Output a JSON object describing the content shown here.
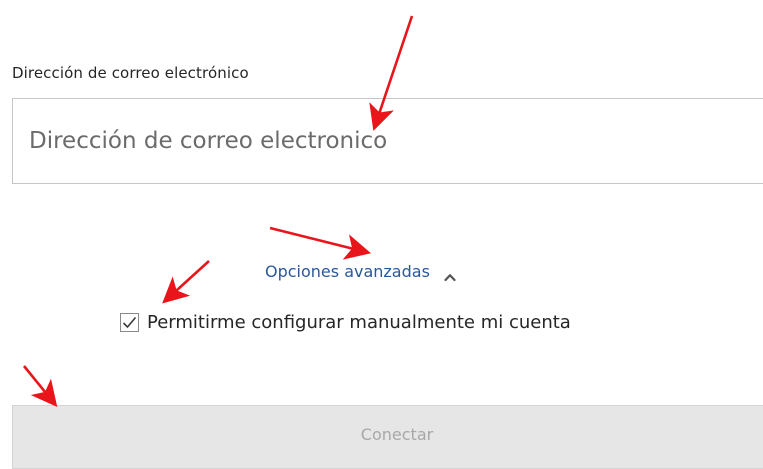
{
  "email": {
    "label": "Dirección de correo electrónico",
    "placeholder": "Dirección de correo electronico",
    "value": ""
  },
  "advanced": {
    "label": "Opciones avanzadas",
    "icon": "chevron-up-icon",
    "expanded": true
  },
  "manual_setup": {
    "label": "Permitirme configurar manualmente mi cuenta",
    "checked": true
  },
  "connect": {
    "label": "Conectar",
    "enabled": false
  },
  "annotations": {
    "arrow_color": "#e8161b",
    "arrow_count": 4
  },
  "colors": {
    "link": "#2b579a",
    "disabled_button_bg": "#e6e6e6",
    "disabled_button_text": "#a8a8a8"
  }
}
